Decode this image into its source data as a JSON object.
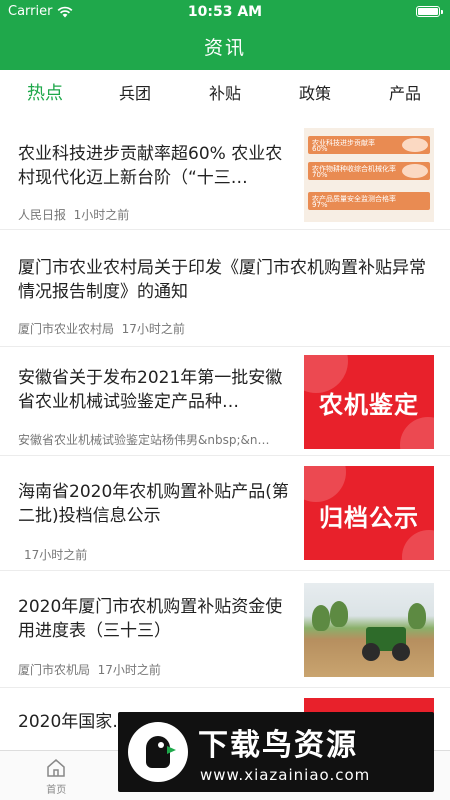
{
  "status_bar": {
    "carrier": "Carrier",
    "time": "10:53 AM"
  },
  "header": {
    "title": "资讯"
  },
  "tabs": [
    {
      "label": "热点",
      "active": true
    },
    {
      "label": "兵团",
      "active": false
    },
    {
      "label": "补贴",
      "active": false
    },
    {
      "label": "政策",
      "active": false
    },
    {
      "label": "产品",
      "active": false
    }
  ],
  "feed": [
    {
      "title": "农业科技进步贡献率超60% 农业农村现代化迈上新台阶（“十三…",
      "source": "人民日报",
      "time": "1小时之前",
      "thumbnail": {
        "kind": "infographic",
        "lines": [
          "农业科技进步贡献率",
          "农作物耕种收综合机械化率",
          "农产品质量安全监测合格率"
        ],
        "figures": [
          "60%",
          "70%",
          "97%"
        ]
      }
    },
    {
      "title": "厦门市农业农村局关于印发《厦门市农机购置补贴异常情况报告制度》的通知",
      "source": "厦门市农业农村局",
      "time": "17小时之前"
    },
    {
      "title": "安徽省关于发布2021年第一批安徽省农业机械试验鉴定产品种…",
      "source": "安徽省农业机械试验鉴定站杨伟男&nbsp;&n…",
      "time": "",
      "thumbnail": {
        "kind": "red-stamp",
        "text": "农机鉴定"
      }
    },
    {
      "title": "海南省2020年农机购置补贴产品(第二批)投档信息公示",
      "source": "",
      "time": "17小时之前",
      "thumbnail": {
        "kind": "red-stamp",
        "text": "归档公示"
      }
    },
    {
      "title": "2020年厦门市农机购置补贴资金使用进度表（三十三）",
      "source": "厦门市农机局",
      "time": "17小时之前",
      "thumbnail": {
        "kind": "photo",
        "subject": "tractor-in-field"
      }
    },
    {
      "title": "2020年国家…鉴定任务完…",
      "source": "",
      "time": "",
      "thumbnail": {
        "kind": "red-stamp",
        "text": ""
      }
    }
  ],
  "tabbar": [
    {
      "label": "首页",
      "icon": "home-icon"
    },
    {
      "label": "",
      "icon": "tab-2-icon"
    },
    {
      "label": "",
      "icon": "tab-3-icon"
    },
    {
      "label": "",
      "icon": "tab-4-icon"
    }
  ],
  "watermark": {
    "title": "下载鸟资源",
    "url": "www.xiazainiao.com"
  },
  "colors": {
    "primary": "#1fa84b",
    "accent_red": "#e8212b",
    "text": "#222222",
    "meta": "#777777"
  }
}
